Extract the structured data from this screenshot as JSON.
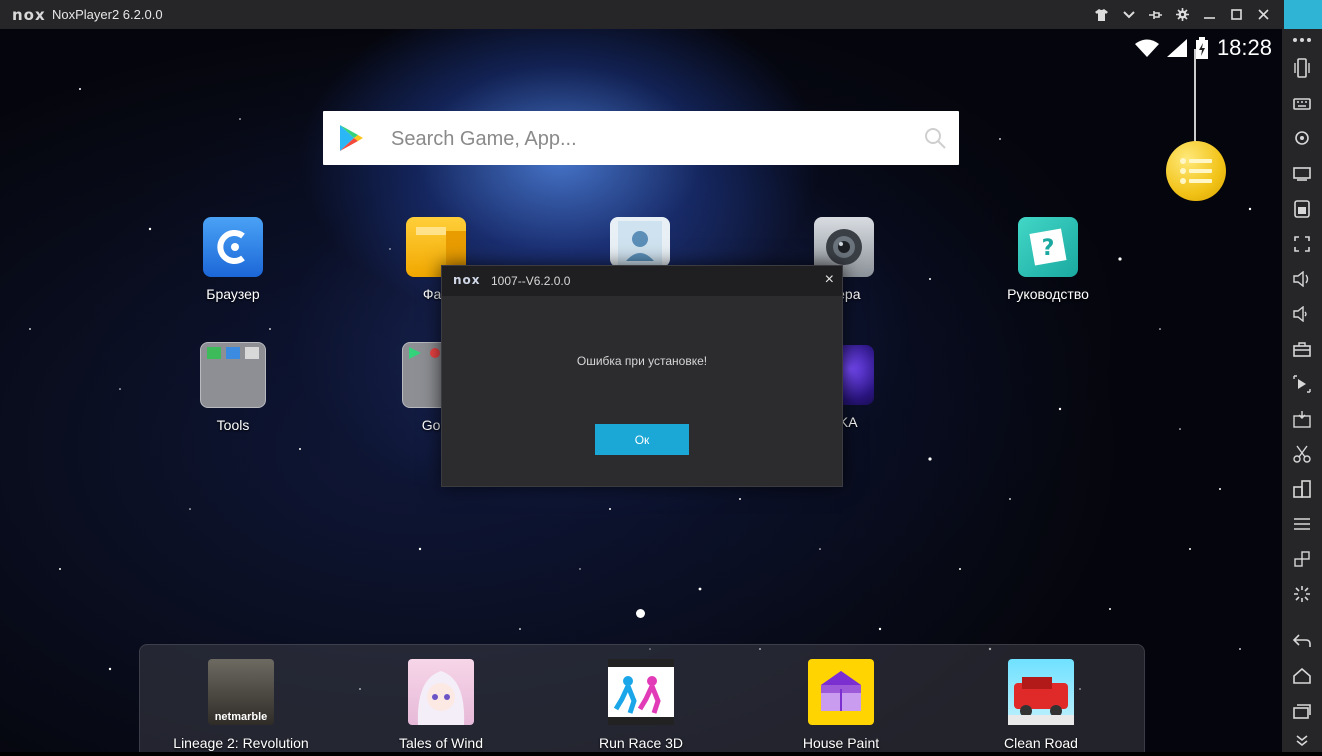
{
  "window": {
    "logo_text": "nox",
    "title": "NoxPlayer2 6.2.0.0",
    "controls": [
      "shirt-icon",
      "chevron-down-icon",
      "pin-icon",
      "gear-icon",
      "minimize-icon",
      "maximize-icon",
      "close-icon"
    ]
  },
  "status": {
    "time": "18:28"
  },
  "search": {
    "placeholder": "Search Game, App..."
  },
  "desktop_apps": [
    {
      "label": "Браузер",
      "icon": "browser-icon"
    },
    {
      "label": "Фай",
      "icon": "files-icon"
    },
    {
      "label": "",
      "icon": "contacts-icon"
    },
    {
      "label": "мера",
      "icon": "camera-icon"
    },
    {
      "label": "Руководство",
      "icon": "guide-icon"
    },
    {
      "label": "Tools",
      "icon": "tools-folder-icon"
    },
    {
      "label": "Goo",
      "icon": "google-folder-icon"
    },
    {
      "label": "FKA",
      "icon": "game-icon"
    }
  ],
  "dock_apps": [
    {
      "label": "Lineage 2: Revolution",
      "icon_text": "netmarble"
    },
    {
      "label": "Tales of Wind"
    },
    {
      "label": "Run Race 3D"
    },
    {
      "label": "House Paint"
    },
    {
      "label": "Clean Road"
    }
  ],
  "dialog": {
    "logo_text": "nox",
    "title": "1007--V6.2.0.0",
    "message": "Ошибка при установке!",
    "ok_label": "Ок",
    "close_glyph": "×"
  },
  "sidebar_icons": [
    "more-icon",
    "shake-icon",
    "keyboard-icon",
    "location-icon",
    "screen-icon",
    "macro-icon",
    "fullscreen-icon",
    "volume-up-icon",
    "volume-down-icon",
    "toolbox-icon",
    "record-icon",
    "apk-icon",
    "scissors-icon",
    "multi-instance-icon",
    "menu-icon",
    "sync-icon",
    "loading-icon",
    "back-icon",
    "home-icon",
    "recent-apps-icon"
  ],
  "colors": {
    "accent": "#1ba8d6",
    "titlebar": "#262629",
    "dialog_bg": "#2c2c2f"
  }
}
